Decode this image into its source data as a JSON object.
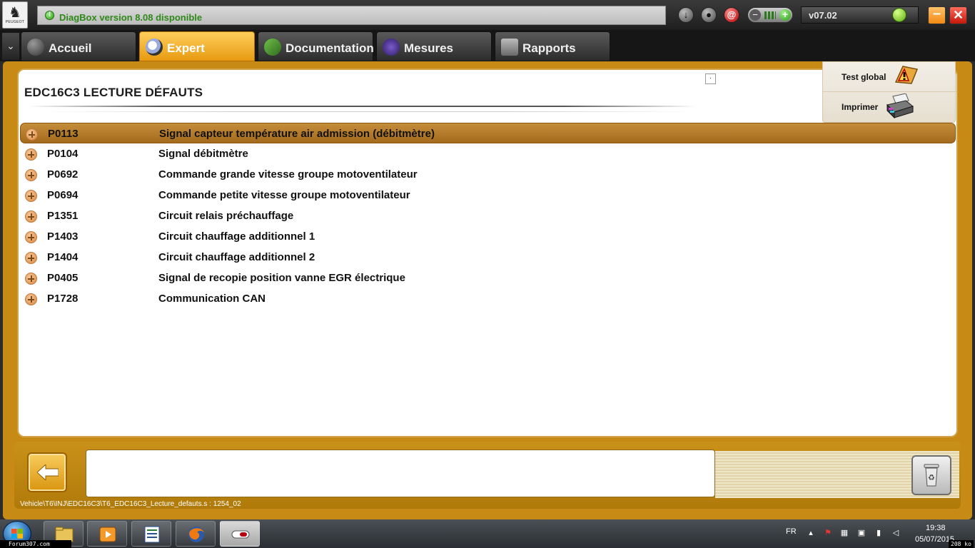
{
  "app": {
    "brand": "PEUGEOT",
    "notice": "DiagBox version 8.08 disponible",
    "version": "v07.02"
  },
  "tabs": [
    {
      "label": "Accueil",
      "icon": "home-icon"
    },
    {
      "label": "Expert",
      "icon": "magnifier-icon"
    },
    {
      "label": "Documentation",
      "icon": "book-icon"
    },
    {
      "label": "Mesures",
      "icon": "waveform-icon"
    },
    {
      "label": "Rapports",
      "icon": "report-icon"
    }
  ],
  "page": {
    "title": "EDC16C3  LECTURE DÉFAUTS",
    "small_box": "·"
  },
  "side_panel": {
    "test_global": "Test global",
    "print": "Imprimer"
  },
  "faults": [
    {
      "code": "P0113",
      "description": "Signal capteur température air admission (débitmètre)",
      "selected": true
    },
    {
      "code": "P0104",
      "description": "Signal débitmètre"
    },
    {
      "code": "P0692",
      "description": "Commande grande vitesse groupe motoventilateur"
    },
    {
      "code": "P0694",
      "description": "Commande petite vitesse groupe motoventilateur"
    },
    {
      "code": "P1351",
      "description": "Circuit relais préchauffage"
    },
    {
      "code": "P1403",
      "description": "Circuit chauffage additionnel 1"
    },
    {
      "code": "P1404",
      "description": "Circuit chauffage additionnel 2"
    },
    {
      "code": "P0405",
      "description": "Signal de recopie position vanne EGR électrique"
    },
    {
      "code": "P1728",
      "description": "Communication CAN"
    }
  ],
  "status": {
    "path": "Vehicle\\T6\\INJ\\EDC16C3\\T6_EDC16C3_Lecture_defauts.s : 1254_02",
    "message": ""
  },
  "taskbar": {
    "watermark": "Forum307.com",
    "language": "FR",
    "time": "19:38",
    "date": "05/07/2015",
    "kb": "208 ko"
  },
  "colors": {
    "accent": "#e8a020",
    "selected_row": "#b07a2c",
    "notice_text": "#2f8a19"
  }
}
